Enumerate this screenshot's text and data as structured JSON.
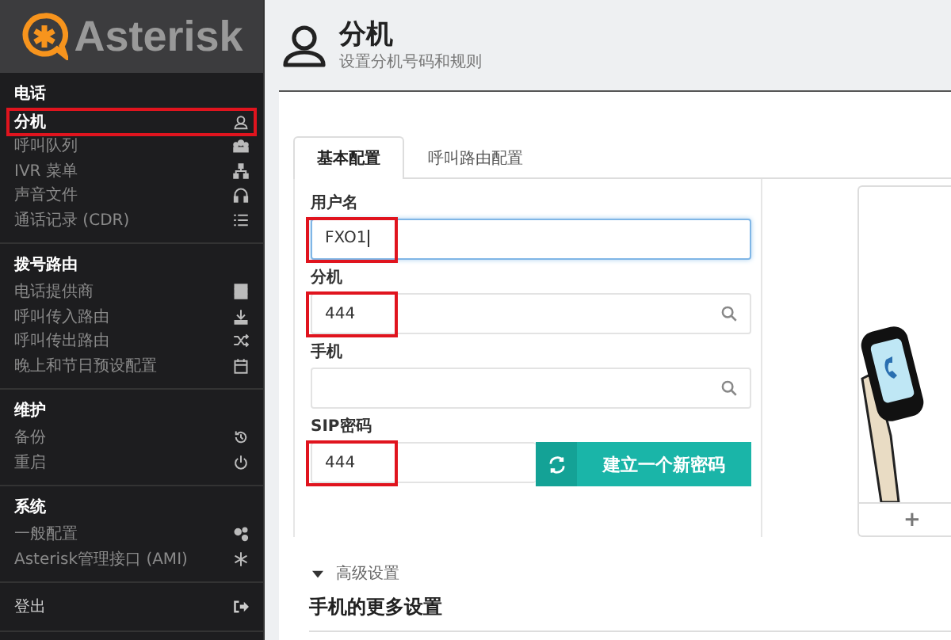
{
  "logo": {
    "text": "Asterisk"
  },
  "sidebar": {
    "sections": [
      {
        "title": "电话",
        "items": [
          {
            "label": "分机",
            "selected": true,
            "highlighted": true
          },
          {
            "label": "呼叫队列",
            "selected": false,
            "highlighted": false
          },
          {
            "label": "IVR 菜单",
            "selected": false,
            "highlighted": false
          },
          {
            "label": "声音文件",
            "selected": false,
            "highlighted": false
          },
          {
            "label": "通话记录 (CDR)",
            "selected": false,
            "highlighted": false
          }
        ]
      },
      {
        "title": "拨号路由",
        "items": [
          {
            "label": "电话提供商",
            "selected": false,
            "highlighted": false
          },
          {
            "label": "呼叫传入路由",
            "selected": false,
            "highlighted": false
          },
          {
            "label": "呼叫传出路由",
            "selected": false,
            "highlighted": false
          },
          {
            "label": "晚上和节日预设配置",
            "selected": false,
            "highlighted": false
          }
        ]
      },
      {
        "title": "维护",
        "items": [
          {
            "label": "备份",
            "selected": false,
            "highlighted": false
          },
          {
            "label": "重启",
            "selected": false,
            "highlighted": false
          }
        ]
      },
      {
        "title": "系统",
        "items": [
          {
            "label": "一般配置",
            "selected": false,
            "highlighted": false
          },
          {
            "label": "Asterisk管理接口 (AMI)",
            "selected": false,
            "highlighted": false
          }
        ]
      }
    ],
    "logout": "登出"
  },
  "page": {
    "title": "分机",
    "subtitle": "设置分机号码和规则"
  },
  "tabs": [
    {
      "label": "基本配置",
      "selected": true
    },
    {
      "label": "呼叫路由配置",
      "selected": false
    }
  ],
  "fields": [
    {
      "kind": "text",
      "label": "用户名",
      "value": "FXO1",
      "focused": true,
      "highlighted": true
    },
    {
      "kind": "search",
      "label": "分机",
      "value": "444",
      "highlighted": true
    },
    {
      "kind": "search",
      "label": "手机"
    },
    {
      "kind": "password",
      "label": "SIP密码",
      "value": "444",
      "highlighted": true,
      "button": "建立一个新密码"
    }
  ],
  "avatar_card": {
    "add": "+"
  },
  "advanced": {
    "label": "高级设置",
    "expanded": true
  },
  "section_heading": "手机的更多设置"
}
